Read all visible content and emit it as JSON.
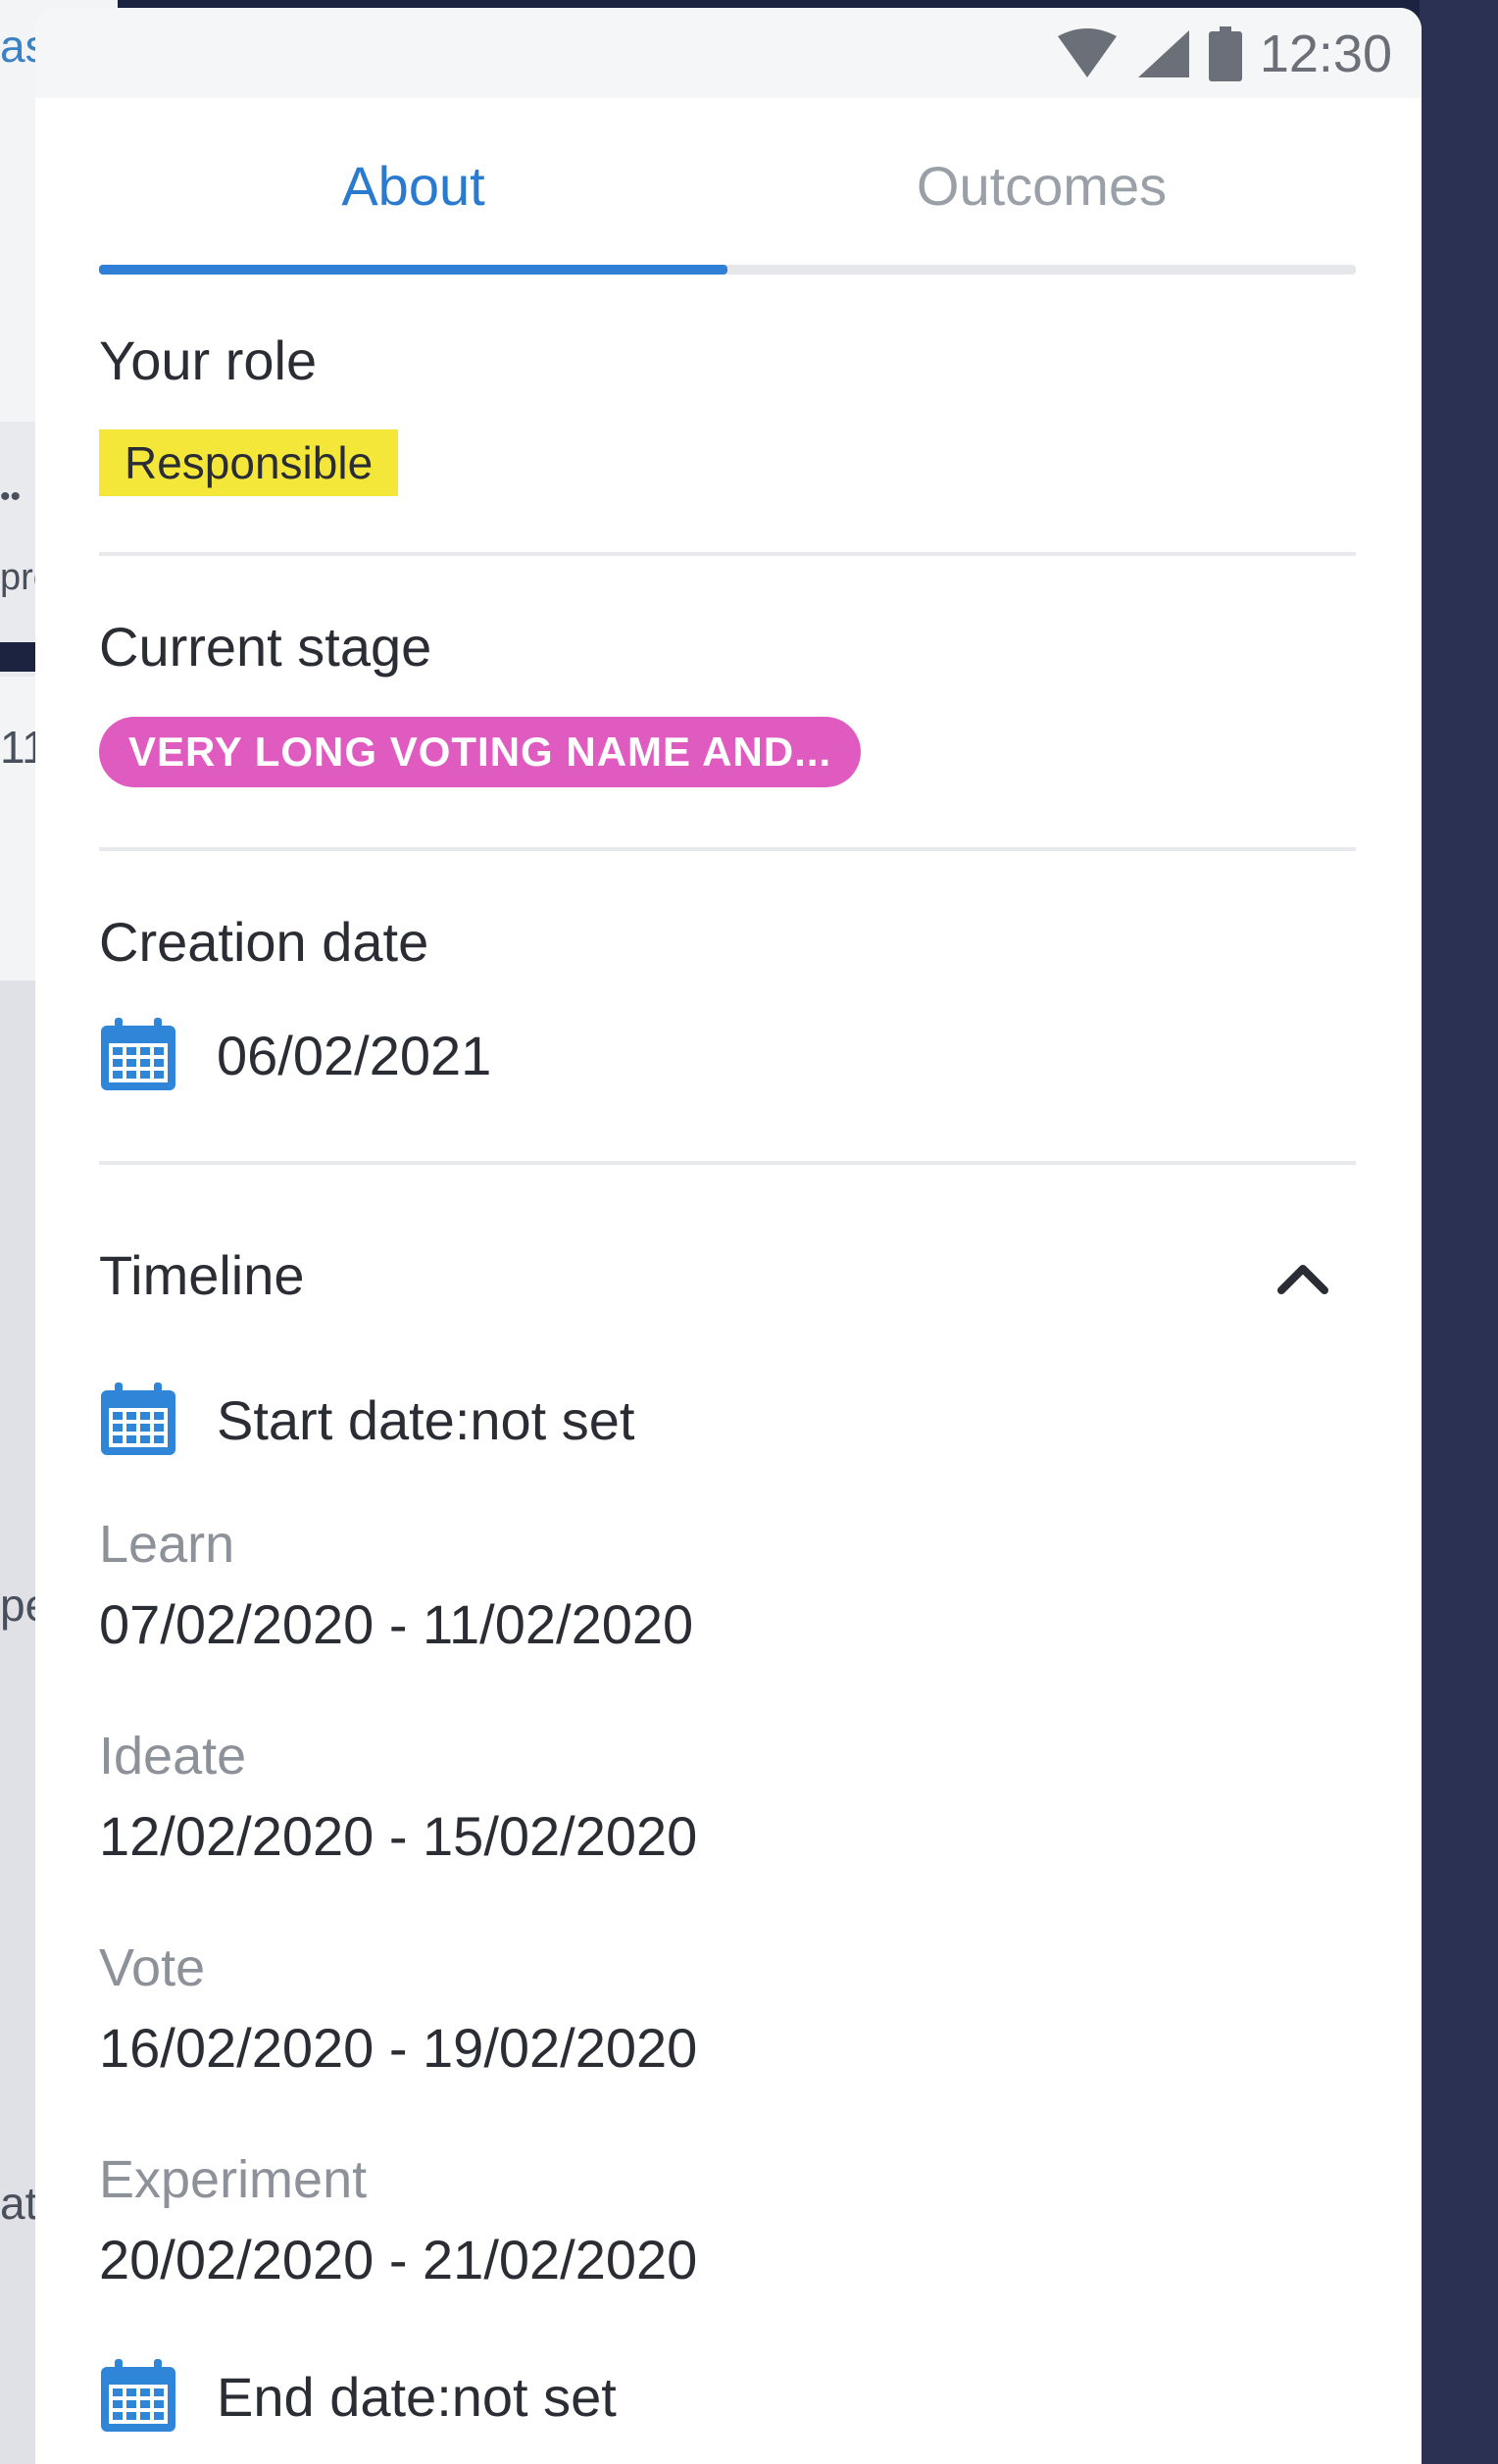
{
  "background": {
    "fragments": [
      "as",
      "••",
      "pre",
      "11",
      "pe",
      "at"
    ]
  },
  "status_bar": {
    "time": "12:30",
    "icons": [
      "wifi-icon",
      "signal-icon",
      "battery-icon"
    ]
  },
  "tabs": {
    "items": [
      {
        "label": "About",
        "active": true
      },
      {
        "label": "Outcomes",
        "active": false
      }
    ]
  },
  "role": {
    "title": "Your role",
    "badge": "Responsible",
    "badge_color": "#f5e63a"
  },
  "stage": {
    "title": "Current stage",
    "badge": "VERY LONG VOTING NAME AND...",
    "badge_color": "#e05bc0"
  },
  "creation": {
    "title": "Creation date",
    "date": "06/02/2021",
    "icon": "calendar-icon"
  },
  "timeline": {
    "title": "Timeline",
    "expanded": true,
    "start": "Start date:not set",
    "stages": [
      {
        "name": "Learn",
        "range": "07/02/2020 - 11/02/2020"
      },
      {
        "name": "Ideate",
        "range": "12/02/2020 - 15/02/2020"
      },
      {
        "name": "Vote",
        "range": "16/02/2020 - 19/02/2020"
      },
      {
        "name": "Experiment",
        "range": "20/02/2020 - 21/02/2020"
      }
    ],
    "end": "End date:not set"
  },
  "colors": {
    "accent": "#2f7fd6",
    "calendar_icon": "#2f86d9"
  }
}
